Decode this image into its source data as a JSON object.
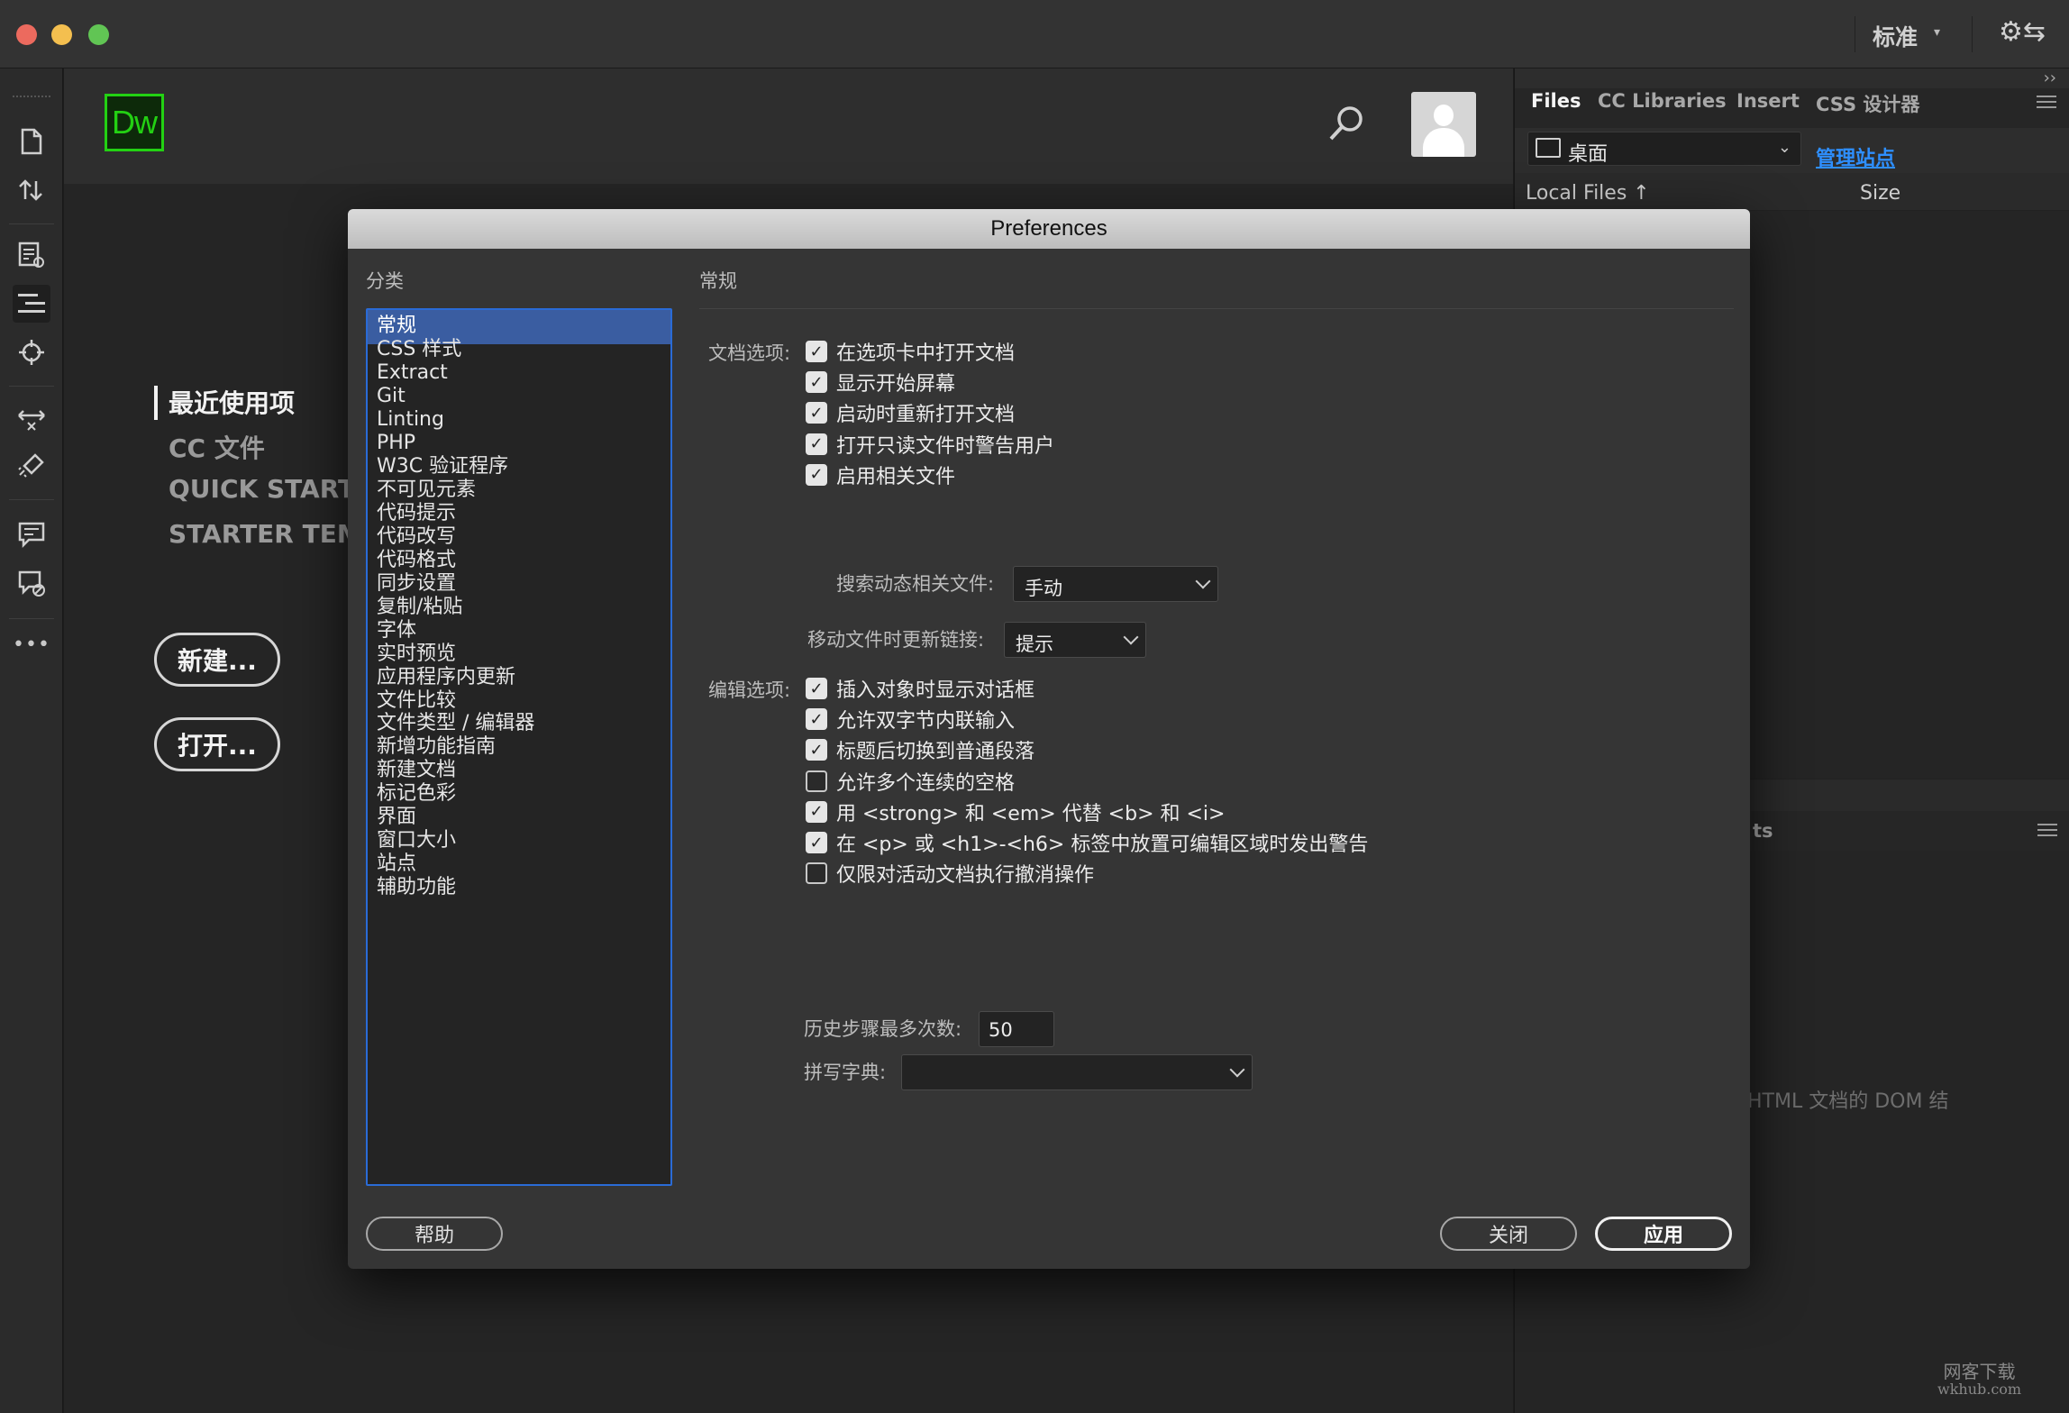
{
  "titlebar": {
    "workspace_label": "标准",
    "workspace_caret": "▾",
    "sync_glyph": "⚙⇆"
  },
  "left_toolbar": {
    "icons": [
      "new-document-icon",
      "get-put-icon",
      "live-view-icon",
      "code-navigator-icon",
      "target-icon",
      "expand-icon",
      "brush-icon",
      "comment-icon",
      "validate-icon",
      "more-icon"
    ],
    "more_label": "•••"
  },
  "start_screen": {
    "logo": "Dw",
    "nav": [
      "最近使用项",
      "CC 文件",
      "QUICK START",
      "STARTER TEMPL"
    ],
    "active_nav": "最近使用项",
    "new_button": "新建...",
    "open_button": "打开..."
  },
  "right_panel": {
    "collapse": "››",
    "tabs": [
      "Files",
      "CC Libraries",
      "Insert",
      "CSS 设计器"
    ],
    "active_tab": "Files",
    "site_select": "桌面",
    "site_caret": "⌄",
    "manage_sites": "管理站点",
    "files_columns": [
      "Local Files ↑",
      "Size"
    ],
    "lower_tab_fragment": "ts",
    "dom_hint": "HTML 文档的 DOM 结"
  },
  "watermark": {
    "line1": "网客下载",
    "line2": "wkhub.com"
  },
  "dialog": {
    "title": "Preferences",
    "category_label": "分类",
    "categories": [
      "常规",
      "CSS 样式",
      "Extract",
      "Git",
      "Linting",
      "PHP",
      "W3C 验证程序",
      "不可见元素",
      "代码提示",
      "代码改写",
      "代码格式",
      "同步设置",
      "复制/粘贴",
      "字体",
      "实时预览",
      "应用程序内更新",
      "文件比较",
      "文件类型 / 编辑器",
      "新增功能指南",
      "新建文档",
      "标记色彩",
      "界面",
      "窗口大小",
      "站点",
      "辅助功能"
    ],
    "selected_category": "常规",
    "section_title": "常规",
    "doc_options_label": "文档选项:",
    "doc_options": [
      {
        "label": "在选项卡中打开文档",
        "checked": true
      },
      {
        "label": "显示开始屏幕",
        "checked": true
      },
      {
        "label": "启动时重新打开文档",
        "checked": true
      },
      {
        "label": "打开只读文件时警告用户",
        "checked": true
      },
      {
        "label": "启用相关文件",
        "checked": true
      }
    ],
    "dynamic_files_label": "搜索动态相关文件:",
    "dynamic_files_value": "手动",
    "update_links_label": "移动文件时更新链接:",
    "update_links_value": "提示",
    "edit_options_label": "编辑选项:",
    "edit_options": [
      {
        "label": "插入对象时显示对话框",
        "checked": true
      },
      {
        "label": "允许双字节内联输入",
        "checked": true
      },
      {
        "label": "标题后切换到普通段落",
        "checked": true
      },
      {
        "label": "允许多个连续的空格",
        "checked": false
      },
      {
        "label": "用 <strong> 和 <em> 代替 <b> 和 <i>",
        "checked": true
      },
      {
        "label": "在 <p> 或 <h1>-<h6> 标签中放置可编辑区域时发出警告",
        "checked": true
      },
      {
        "label": "仅限对活动文档执行撤消操作",
        "checked": false
      }
    ],
    "history_label": "历史步骤最多次数:",
    "history_value": "50",
    "spelling_label": "拼写字典:",
    "spelling_value": "",
    "check_glyph": "✓",
    "buttons": {
      "help": "帮助",
      "close": "关闭",
      "apply": "应用"
    }
  }
}
